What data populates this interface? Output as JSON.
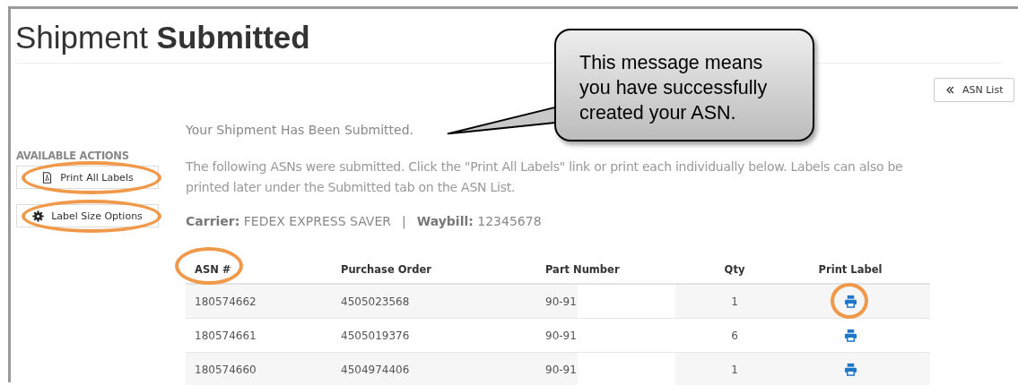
{
  "page": {
    "title": "Shipment **Submitted**"
  },
  "back_button": {
    "label": "ASN List"
  },
  "sidebar": {
    "heading": "AVAILABLE ACTIONS",
    "actions": [
      {
        "kind": "pdf",
        "label": "Print All Labels",
        "highlighted": true
      },
      {
        "kind": "gear",
        "label": "Label Size Options",
        "highlighted": true
      }
    ]
  },
  "message": "Your Shipment Has Been Submitted.",
  "description": "The following ASNs were submitted. Click the \"Print All Labels\" link or print each individually below. Labels can also be printed later under the Submitted tab on the ASN List.",
  "details": [
    {
      "label": "Carrier:",
      "value": "FEDEX EXPRESS SAVER"
    },
    {
      "label": "Waybill:",
      "value": "12345678"
    }
  ],
  "separator": "|",
  "table": {
    "columns": [
      {
        "label": "ASN #",
        "highlighted": true
      },
      {
        "label": "Purchase Order",
        "highlighted": false
      },
      {
        "label": "Part Number",
        "highlighted": false
      },
      {
        "label": "Qty",
        "highlighted": false
      },
      {
        "label": "Print Label",
        "highlighted": false
      }
    ],
    "rows": [
      {
        "asn": "180574662",
        "purchase_order": "4505023568",
        "part_number": "90-91",
        "qty": "1",
        "print_highlighted": true
      },
      {
        "asn": "180574661",
        "purchase_order": "4505019376",
        "part_number": "90-91",
        "qty": "6",
        "print_highlighted": false
      },
      {
        "asn": "180574660",
        "purchase_order": "4504974406",
        "part_number": "90-91",
        "qty": "1",
        "print_highlighted": false
      }
    ]
  },
  "callout": {
    "text": "This message means you have successfully created your ASN."
  }
}
